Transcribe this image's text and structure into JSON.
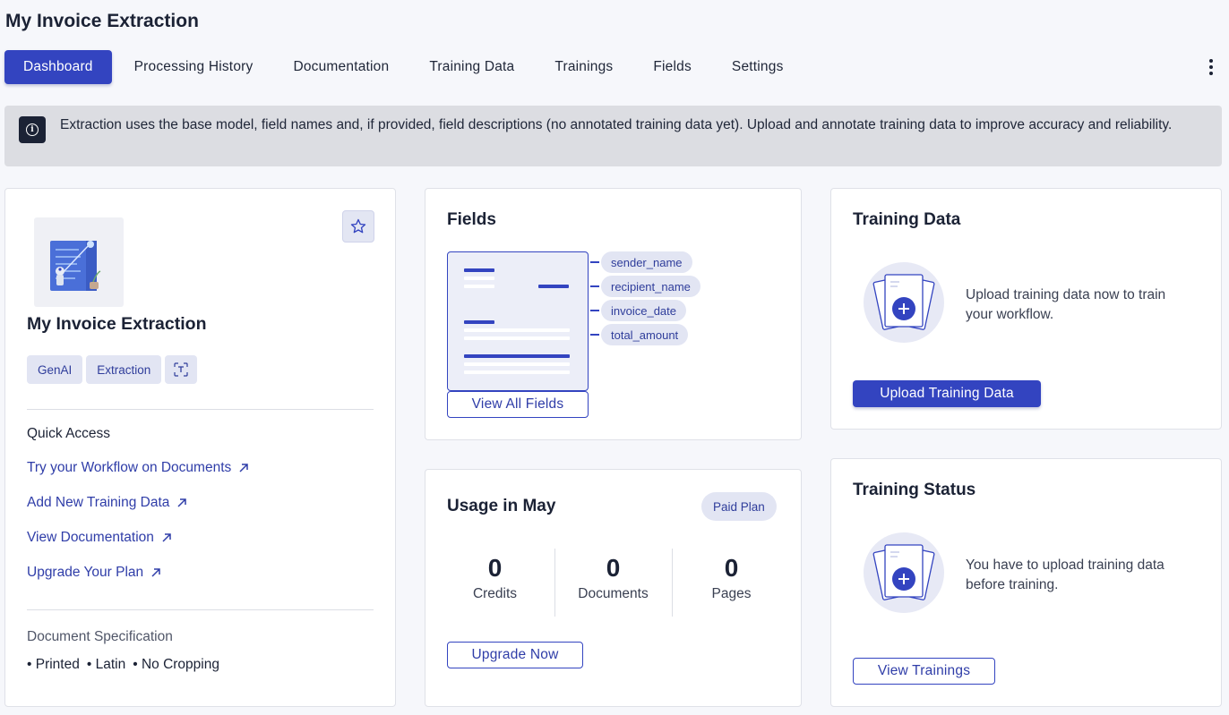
{
  "app": {
    "title": "My Invoice Extraction"
  },
  "tabs": [
    {
      "label": "Dashboard",
      "active": true
    },
    {
      "label": "Processing History",
      "active": false
    },
    {
      "label": "Documentation",
      "active": false
    },
    {
      "label": "Training Data",
      "active": false
    },
    {
      "label": "Trainings",
      "active": false
    },
    {
      "label": "Fields",
      "active": false
    },
    {
      "label": "Settings",
      "active": false
    }
  ],
  "banner": {
    "icon": "info-icon",
    "text": "Extraction uses the base model, field names and, if provided, field descriptions (no annotated training data yet). Upload and annotate training data to improve accuracy and reliability."
  },
  "workflow_card": {
    "title": "My Invoice Extraction",
    "chips": [
      "GenAI",
      "Extraction"
    ],
    "chip_icon": "text-scan-icon",
    "quick_access": {
      "heading": "Quick Access",
      "links": [
        "Try your Workflow on Documents",
        "Add New Training Data",
        "View Documentation",
        "Upgrade Your Plan"
      ]
    },
    "spec": {
      "heading": "Document Specification",
      "items": [
        "• Printed",
        "• Latin",
        "• No Cropping"
      ]
    }
  },
  "fields_card": {
    "title": "Fields",
    "fields": [
      "sender_name",
      "recipient_name",
      "invoice_date",
      "total_amount"
    ],
    "button": "View All Fields"
  },
  "usage_card": {
    "title": "Usage in May",
    "plan": "Paid Plan",
    "stats": [
      {
        "value": "0",
        "label": "Credits"
      },
      {
        "value": "0",
        "label": "Documents"
      },
      {
        "value": "0",
        "label": "Pages"
      }
    ],
    "button": "Upgrade Now"
  },
  "training_data_card": {
    "title": "Training Data",
    "message": "Upload training data now to train your workflow.",
    "button": "Upload Training Data"
  },
  "training_status_card": {
    "title": "Training Status",
    "message": "You have to upload training data before training.",
    "button": "View Trainings"
  },
  "colors": {
    "accent": "#3344c0",
    "banner_bg": "#dcdde2",
    "chip_bg": "#e2e5f3",
    "page_bg": "#f6f7fb"
  }
}
